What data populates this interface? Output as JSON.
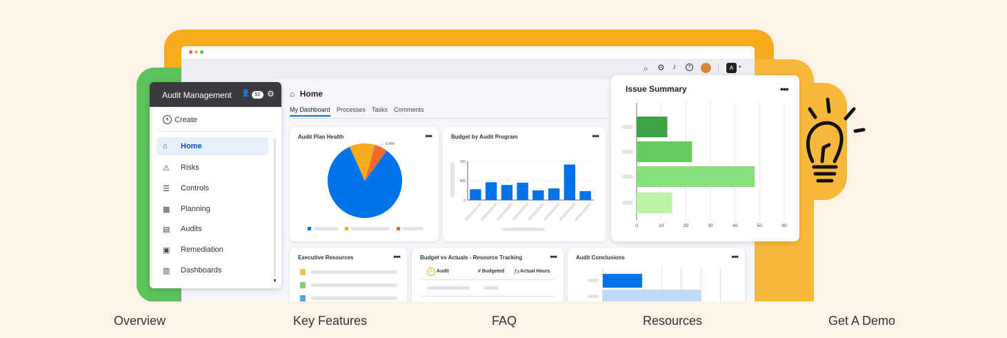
{
  "sidebar": {
    "title": "Audit Management",
    "badge": "52",
    "create_label": "Create",
    "items": [
      {
        "label": "Home",
        "icon": "home-icon",
        "glyph": "⌂",
        "active": true
      },
      {
        "label": "Risks",
        "icon": "warning-icon",
        "glyph": "⚠"
      },
      {
        "label": "Controls",
        "icon": "sliders-icon",
        "glyph": "☰"
      },
      {
        "label": "Planning",
        "icon": "calendar-icon",
        "glyph": "▦"
      },
      {
        "label": "Audits",
        "icon": "clipboard-icon",
        "glyph": "▤"
      },
      {
        "label": "Remediation",
        "icon": "task-icon",
        "glyph": "▣"
      },
      {
        "label": "Dashboards",
        "icon": "dashboard-icon",
        "glyph": "▥"
      }
    ]
  },
  "header": {
    "page_title": "Home",
    "avatar_letter": "A",
    "tabs": [
      "My Dashboard",
      "Processes",
      "Tasks",
      "Comments"
    ]
  },
  "cards": {
    "plan_health": "Audit Plan Health",
    "budget_program": "Budget by Audit Program",
    "issue_summary": "Issue Summary",
    "exec_resources": "Executive Resources",
    "budget_actuals": "Budget vs Actuals - Resource Tracking",
    "conclusions": "Audit Conclusions",
    "col_audit": "Audit",
    "col_budgeted": "# Budgeted",
    "col_actual": "Actual Hours"
  },
  "colors": {
    "accent": "#0073ea",
    "green_frame": "#5cc25a",
    "orange_frame": "#f8ab1c"
  },
  "chart_data": [
    {
      "type": "pie",
      "title": "Audit Plan Health",
      "values": [
        83.3,
        11.1,
        5.6
      ],
      "labels": [
        "83.3%",
        "11.1%",
        "5.6%"
      ],
      "colors": [
        "#0073ea",
        "#f9ab1c",
        "#ef6a2c"
      ]
    },
    {
      "type": "bar",
      "title": "Budget by Audit Program",
      "ylim": [
        0,
        1000
      ],
      "yticks": [
        "100",
        "500",
        "0"
      ],
      "values": [
        280,
        460,
        390,
        450,
        250,
        300,
        920,
        230
      ]
    },
    {
      "type": "bar",
      "orientation": "horizontal",
      "title": "Issue Summary",
      "xlim": [
        0,
        60
      ],
      "xticks": [
        "0",
        "10",
        "20",
        "30",
        "40",
        "50",
        "60"
      ],
      "values": [
        12.5,
        22.5,
        48,
        14.5
      ],
      "colors": [
        "#3fa244",
        "#66cc5e",
        "#86e07c",
        "#baf3a8"
      ]
    }
  ],
  "nav": {
    "overview": "Overview",
    "features": "Key Features",
    "faq": "FAQ",
    "resources": "Resources",
    "demo": "Get A Demo"
  }
}
